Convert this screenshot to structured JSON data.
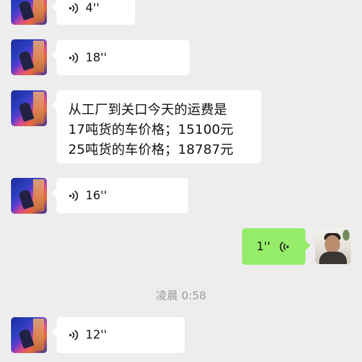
{
  "messages": [
    {
      "duration": "4''"
    },
    {
      "duration": "18''"
    },
    {
      "lines": [
        "从工厂到关口今天的运费是",
        "17吨货的车价格；15100元",
        "25吨货的车价格；18787元"
      ]
    },
    {
      "duration": "16''"
    },
    {
      "duration": "1''"
    },
    {
      "timestamp": "凌晨 0:58"
    },
    {
      "duration": "12''"
    }
  ],
  "colors": {
    "background": "#ededed",
    "incoming_bubble": "#ffffff",
    "outgoing_bubble": "#95ec69",
    "timestamp_text": "#9b9b9b"
  },
  "icons": [
    "voice-wave-icon"
  ]
}
